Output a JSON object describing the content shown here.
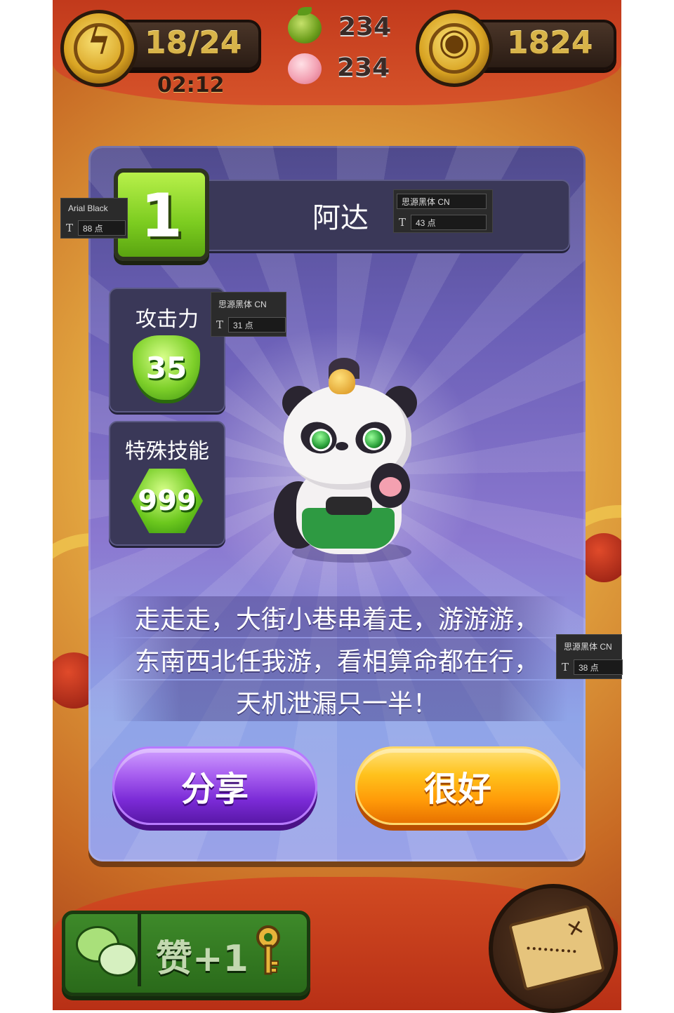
{
  "hud": {
    "energy": "18/24",
    "timer": "02:12",
    "orange_count": "234",
    "peach_count": "234",
    "coins": "1824",
    "energy_icon": "lightning-coin-icon",
    "coin_icon": "gold-coin-icon"
  },
  "panel": {
    "level": "1",
    "character_name": "阿达",
    "attack_label": "攻击力",
    "attack_value": "35",
    "skill_label": "特殊技能",
    "skill_value": "999",
    "quote_lines": [
      "走走走，大街小巷串着走，游游游，",
      "东南西北任我游，看相算命都在行，",
      "天机泄漏只一半！"
    ],
    "share_label": "分享",
    "ok_label": "很好"
  },
  "bottom": {
    "like_label": "赞+1",
    "wechat_icon": "wechat-icon",
    "key_icon": "key-icon",
    "map_icon": "treasure-map-icon"
  },
  "annotations": [
    {
      "font": "Arial Black",
      "size": "88 点"
    },
    {
      "font": "思源黑体 CN",
      "size": "43 点"
    },
    {
      "font": "思源黑体 CN",
      "size": "31 点"
    },
    {
      "font": "思源黑体 CN",
      "size": "38 点"
    }
  ],
  "colors": {
    "panel_top": "#4f4a8c",
    "panel_bottom": "#9aa2e8",
    "level_badge": "#7ccc20",
    "share_button": "#a860f0",
    "ok_button": "#ffc21c",
    "hud_text": "#d8b44a"
  }
}
